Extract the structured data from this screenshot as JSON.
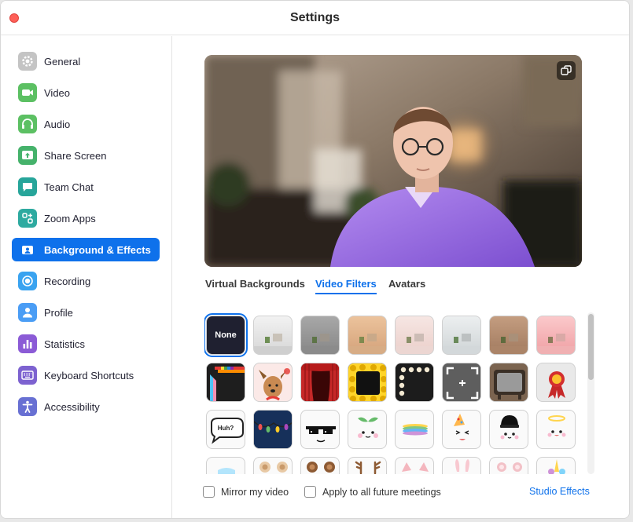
{
  "window": {
    "title": "Settings"
  },
  "sidebar": {
    "items": [
      {
        "label": "General",
        "icon": "gear-icon",
        "color": "#b9b9b9",
        "active": false
      },
      {
        "label": "Video",
        "icon": "video-camera-icon",
        "color": "#5cc063",
        "active": false
      },
      {
        "label": "Audio",
        "icon": "headphones-icon",
        "color": "#5cc063",
        "active": false
      },
      {
        "label": "Share Screen",
        "icon": "share-screen-icon",
        "color": "#45b26b",
        "active": false
      },
      {
        "label": "Team Chat",
        "icon": "chat-bubble-icon",
        "color": "#27a59a",
        "active": false
      },
      {
        "label": "Zoom Apps",
        "icon": "apps-icon",
        "color": "#2eaaa0",
        "active": false
      },
      {
        "label": "Background & Effects",
        "icon": "portrait-icon",
        "color": "#0e71eb",
        "active": true
      },
      {
        "label": "Recording",
        "icon": "record-icon",
        "color": "#3aa3f0",
        "active": false
      },
      {
        "label": "Profile",
        "icon": "person-icon",
        "color": "#4a9df5",
        "active": false
      },
      {
        "label": "Statistics",
        "icon": "bar-chart-icon",
        "color": "#8b5bd6",
        "active": false
      },
      {
        "label": "Keyboard Shortcuts",
        "icon": "keyboard-icon",
        "color": "#7d62d0",
        "active": false
      },
      {
        "label": "Accessibility",
        "icon": "accessibility-icon",
        "color": "#6870d3",
        "active": false
      }
    ]
  },
  "preview": {
    "icon": "rotate-camera-icon"
  },
  "tabs": [
    {
      "label": "Virtual Backgrounds",
      "active": false
    },
    {
      "label": "Video Filters",
      "active": true
    },
    {
      "label": "Avatars",
      "active": false
    }
  ],
  "filters": {
    "tiles": [
      {
        "name": "none",
        "label": "None",
        "selected": true
      },
      {
        "name": "light-gray-room",
        "color": "#e6e6e6"
      },
      {
        "name": "gray-room",
        "color": "#9a9a9a"
      },
      {
        "name": "warm-tan-room",
        "color": "#e2b58e"
      },
      {
        "name": "pink-light-room",
        "color": "#f2dcd8"
      },
      {
        "name": "cool-light-room",
        "color": "#dfe3e5"
      },
      {
        "name": "brown-room",
        "color": "#b48d70"
      },
      {
        "name": "rose-room",
        "color": "#f6b6b8"
      },
      {
        "name": "pride-frame"
      },
      {
        "name": "dog-reindeer"
      },
      {
        "name": "theater-curtains"
      },
      {
        "name": "emoji-frame"
      },
      {
        "name": "lightbulb-frame"
      },
      {
        "name": "focus-frame"
      },
      {
        "name": "retro-tv"
      },
      {
        "name": "ribbon-badge"
      },
      {
        "name": "huh-bubble",
        "text": "Huh?"
      },
      {
        "name": "string-lights"
      },
      {
        "name": "pixel-sunglasses"
      },
      {
        "name": "sprout-face"
      },
      {
        "name": "rainbow-halo"
      },
      {
        "name": "party-hat-face"
      },
      {
        "name": "beanie-face"
      },
      {
        "name": "angel-halo-face"
      },
      {
        "name": "face-mask"
      },
      {
        "name": "bear-ears"
      },
      {
        "name": "brown-bear-ears"
      },
      {
        "name": "reindeer-antlers"
      },
      {
        "name": "pig-ears"
      },
      {
        "name": "bunny-ears"
      },
      {
        "name": "cat-ears"
      },
      {
        "name": "unicorn-horn"
      }
    ]
  },
  "footer": {
    "mirror_label": "Mirror my video",
    "apply_label": "Apply to all future meetings",
    "mirror_checked": false,
    "apply_checked": false,
    "studio_effects": "Studio Effects"
  }
}
